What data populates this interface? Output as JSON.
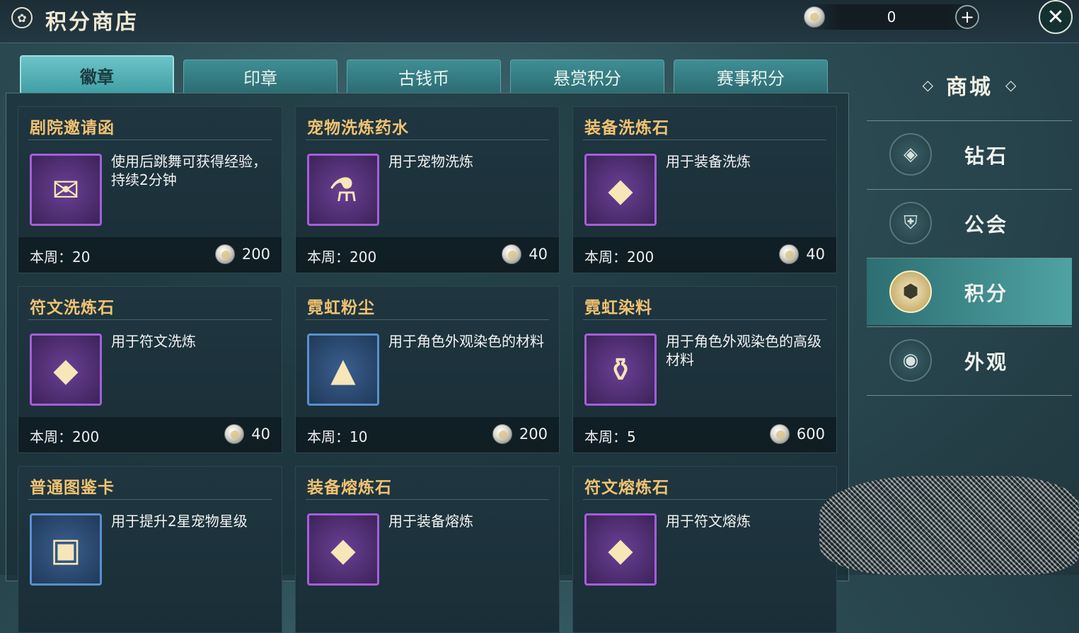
{
  "header": {
    "title": "积分商店",
    "currency_value": "0",
    "plus_label": "+",
    "close_label": "✕"
  },
  "tabs": [
    {
      "label": "徽章",
      "active": true
    },
    {
      "label": "印章",
      "active": false
    },
    {
      "label": "古钱币",
      "active": false
    },
    {
      "label": "悬赏积分",
      "active": false
    },
    {
      "label": "赛事积分",
      "active": false
    }
  ],
  "items": [
    {
      "name": "剧院邀请函",
      "desc": "使用后跳舞可获得经验，持续2分钟",
      "limit": "本周：20",
      "price": "200",
      "icon": "invitation-letter-icon",
      "frame": "purple",
      "glyph": "✉"
    },
    {
      "name": "宠物洗炼药水",
      "desc": "用于宠物洗炼",
      "limit": "本周：200",
      "price": "40",
      "icon": "potion-icon",
      "frame": "purple",
      "glyph": "⚗"
    },
    {
      "name": "装备洗炼石",
      "desc": "用于装备洗炼",
      "limit": "本周：200",
      "price": "40",
      "icon": "orange-crystal-icon",
      "frame": "purple",
      "glyph": "◆"
    },
    {
      "name": "符文洗炼石",
      "desc": "用于符文洗炼",
      "limit": "本周：200",
      "price": "40",
      "icon": "purple-crystal-icon",
      "frame": "purple",
      "glyph": "◆"
    },
    {
      "name": "霓虹粉尘",
      "desc": "用于角色外观染色的材料",
      "limit": "本周：10",
      "price": "200",
      "icon": "rainbow-dust-icon",
      "frame": "blue",
      "glyph": "▲"
    },
    {
      "name": "霓虹染料",
      "desc": "用于角色外观染色的高级材料",
      "limit": "本周：5",
      "price": "600",
      "icon": "dye-bottle-icon",
      "frame": "purple",
      "glyph": "⚱"
    },
    {
      "name": "普通图鉴卡",
      "desc": "用于提升2星宠物星级",
      "limit": "",
      "price": "",
      "icon": "card-icon",
      "frame": "blue",
      "glyph": "▣"
    },
    {
      "name": "装备熔炼石",
      "desc": "用于装备熔炼",
      "limit": "",
      "price": "",
      "icon": "amber-ore-icon",
      "frame": "purple",
      "glyph": "◆"
    },
    {
      "name": "符文熔炼石",
      "desc": "用于符文熔炼",
      "limit": "",
      "price": "",
      "icon": "violet-ore-icon",
      "frame": "purple",
      "glyph": "◆"
    }
  ],
  "sidebar": {
    "title": "商城",
    "deco_left": "◇",
    "deco_right": "◇",
    "items": [
      {
        "label": "钻石",
        "icon": "diamond-icon",
        "glyph": "◈",
        "active": false
      },
      {
        "label": "公会",
        "icon": "guild-banner-icon",
        "glyph": "⛨",
        "active": false
      },
      {
        "label": "积分",
        "icon": "points-hexagon-icon",
        "glyph": "⬢",
        "active": true
      },
      {
        "label": "外观",
        "icon": "appearance-icon",
        "glyph": "◉",
        "active": false
      }
    ]
  },
  "colors": {
    "accent": "#f1c271",
    "tab_active": "#6cc3c7",
    "frame_purple": "#a45fd8",
    "frame_blue": "#5a8fd0"
  }
}
